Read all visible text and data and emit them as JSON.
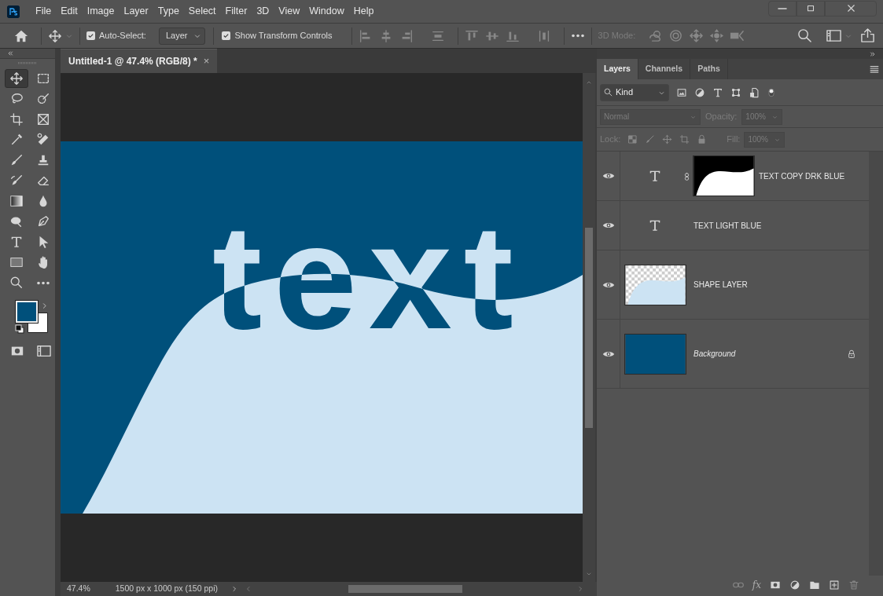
{
  "menu": [
    "File",
    "Edit",
    "Image",
    "Layer",
    "Type",
    "Select",
    "Filter",
    "3D",
    "View",
    "Window",
    "Help"
  ],
  "options_bar": {
    "auto_select": {
      "label": "Auto-Select:",
      "checked": true
    },
    "auto_select_target": "Layer",
    "transform_controls": {
      "label": "Show Transform Controls",
      "checked": true
    },
    "mode_3d_label": "3D Mode:"
  },
  "tools": [
    {
      "kind": "move",
      "selected": true
    },
    {
      "kind": "marquee",
      "selected": false
    },
    {
      "kind": "lasso",
      "selected": false
    },
    {
      "kind": "quickselect",
      "selected": false
    },
    {
      "kind": "crop",
      "selected": false
    },
    {
      "kind": "frame",
      "selected": false
    },
    {
      "kind": "eyedropper",
      "selected": false
    },
    {
      "kind": "healing",
      "selected": false
    },
    {
      "kind": "brush",
      "selected": false
    },
    {
      "kind": "stamp",
      "selected": false
    },
    {
      "kind": "historybrush",
      "selected": false
    },
    {
      "kind": "eraser",
      "selected": false
    },
    {
      "kind": "gradient",
      "selected": false
    },
    {
      "kind": "blur",
      "selected": false
    },
    {
      "kind": "dodge",
      "selected": false
    },
    {
      "kind": "pen",
      "selected": false
    },
    {
      "kind": "type",
      "selected": false
    },
    {
      "kind": "pathselect",
      "selected": false
    },
    {
      "kind": "rectangle",
      "selected": false
    },
    {
      "kind": "hand",
      "selected": false
    },
    {
      "kind": "zoom",
      "selected": false
    },
    {
      "kind": "more",
      "selected": false
    }
  ],
  "document": {
    "tab_title": "Untitled-1 @ 47.4% (RGB/8) *",
    "tab_close": "×",
    "canvas_text": "text"
  },
  "status_bar": {
    "zoom": "47.4%",
    "doc_info": "1500 px x 1000 px (150 ppi)"
  },
  "layers_panel": {
    "tabs": [
      {
        "label": "Layers",
        "selected": true
      },
      {
        "label": "Channels",
        "selected": false
      },
      {
        "label": "Paths",
        "selected": false
      }
    ],
    "filter": "Kind",
    "blend_mode": "Normal",
    "blend_disabled": true,
    "opacity_label": "Opacity:",
    "opacity": "100%",
    "lock_label": "Lock:",
    "fill_label": "Fill:",
    "fill": "100%",
    "layers": [
      {
        "name": "TEXT COPY DRK BLUE",
        "kind": "text",
        "visible": true,
        "mask": true,
        "locked": false
      },
      {
        "name": "TEXT LIGHT BLUE",
        "kind": "text",
        "visible": true,
        "mask": false,
        "locked": false
      },
      {
        "name": "SHAPE LAYER",
        "kind": "shape",
        "visible": true,
        "mask": false,
        "locked": false
      },
      {
        "name": "Background",
        "kind": "background",
        "visible": true,
        "mask": false,
        "locked": true
      }
    ],
    "footer_fx": "fx"
  }
}
